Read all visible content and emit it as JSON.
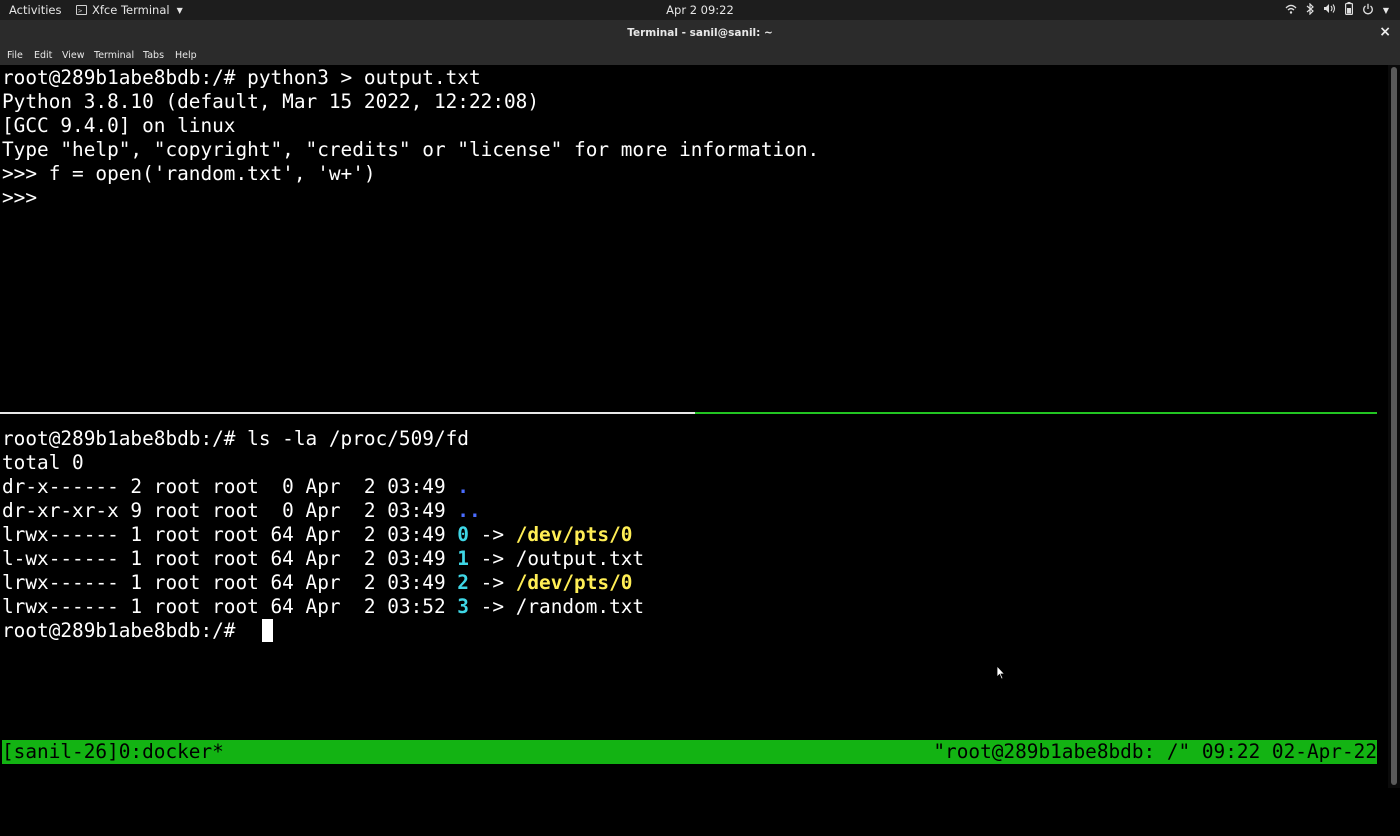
{
  "topbar": {
    "activities": "Activities",
    "app_name": "Xfce Terminal",
    "clock": "Apr 2  09:22",
    "tray_icons": [
      "wifi-icon",
      "bluetooth-icon",
      "volume-icon",
      "battery-icon",
      "power-icon"
    ]
  },
  "window": {
    "title": "Terminal - sanil@sanil: ~",
    "close_label": "×"
  },
  "menu": {
    "file": "File",
    "edit": "Edit",
    "view": "View",
    "terminal": "Terminal",
    "tabs": "Tabs",
    "help": "Help"
  },
  "top_pane": {
    "lines": [
      "root@289b1abe8bdb:/# python3 > output.txt",
      "Python 3.8.10 (default, Mar 15 2022, 12:22:08)",
      "[GCC 9.4.0] on linux",
      "Type \"help\", \"copyright\", \"credits\" or \"license\" for more information.",
      ">>> f = open('random.txt', 'w+')",
      ">>>"
    ]
  },
  "bottom_pane": {
    "command": "root@289b1abe8bdb:/# ls -la /proc/509/fd",
    "total": "total 0",
    "entries": [
      {
        "meta": "dr-x------ 2 root root  0 Apr  2 03:49 ",
        "name": ".",
        "arrow": "",
        "target": ""
      },
      {
        "meta": "dr-xr-xr-x 9 root root  0 Apr  2 03:49 ",
        "name": "..",
        "arrow": "",
        "target": ""
      },
      {
        "meta": "lrwx------ 1 root root 64 Apr  2 03:49 ",
        "name": "0",
        "arrow": " -> ",
        "target": "/dev/pts/0"
      },
      {
        "meta": "l-wx------ 1 root root 64 Apr  2 03:49 ",
        "name": "1",
        "arrow": " -> ",
        "target": "/output.txt"
      },
      {
        "meta": "lrwx------ 1 root root 64 Apr  2 03:49 ",
        "name": "2",
        "arrow": " -> ",
        "target": "/dev/pts/0"
      },
      {
        "meta": "lrwx------ 1 root root 64 Apr  2 03:52 ",
        "name": "3",
        "arrow": " -> ",
        "target": "/random.txt"
      }
    ],
    "prompt": "root@289b1abe8bdb:/# "
  },
  "statusbar": {
    "left": "[sanil-26]0:docker*",
    "right": "\"root@289b1abe8bdb: /\" 09:22 02-Apr-22"
  },
  "colors": {
    "status_green": "#13b313",
    "active_pane_border": "#22c422",
    "fd_number": "#3fd7e6",
    "symlink_target_device": "#ffee55",
    "directory": "#4a6cff"
  }
}
